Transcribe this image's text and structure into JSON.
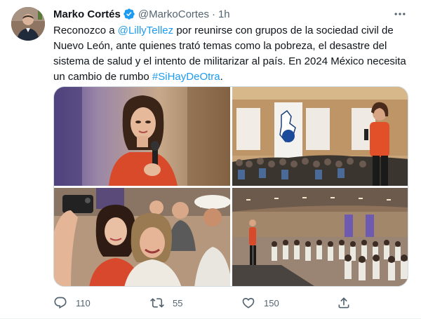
{
  "tweet": {
    "author_name": "Marko Cortés",
    "handle": "@MarkoCortes",
    "separator": "·",
    "time": "1h",
    "text_segments": [
      {
        "text": "Reconozco a ",
        "type": "text"
      },
      {
        "text": "@LillyTellez",
        "type": "mention"
      },
      {
        "text": " por reunirse con grupos de la sociedad civil de Nuevo León, ante quienes trató temas como la pobreza, el desastre del sistema de salud y el intento de militarizar al país. En 2024 México necesita un cambio de rumbo ",
        "type": "text"
      },
      {
        "text": "#SiHayDeOtra",
        "type": "hashtag"
      },
      {
        "text": ".",
        "type": "text"
      }
    ],
    "images": [
      {
        "name": "photo-woman-microphone"
      },
      {
        "name": "photo-speaker-stage-pan-banner"
      },
      {
        "name": "photo-group-selfie"
      },
      {
        "name": "photo-audience-hall"
      }
    ],
    "actions": {
      "reply_count": "110",
      "retweet_count": "55",
      "like_count": "150"
    }
  },
  "icons": {
    "verified": "verified-badge-icon",
    "more": "more-options-icon",
    "reply": "reply-icon",
    "retweet": "retweet-icon",
    "like": "heart-icon",
    "share": "share-icon"
  },
  "colors": {
    "accent": "#1d9bf0",
    "hashtag": "#1d9bf0",
    "muted": "#536471",
    "text": "#0f1419"
  }
}
